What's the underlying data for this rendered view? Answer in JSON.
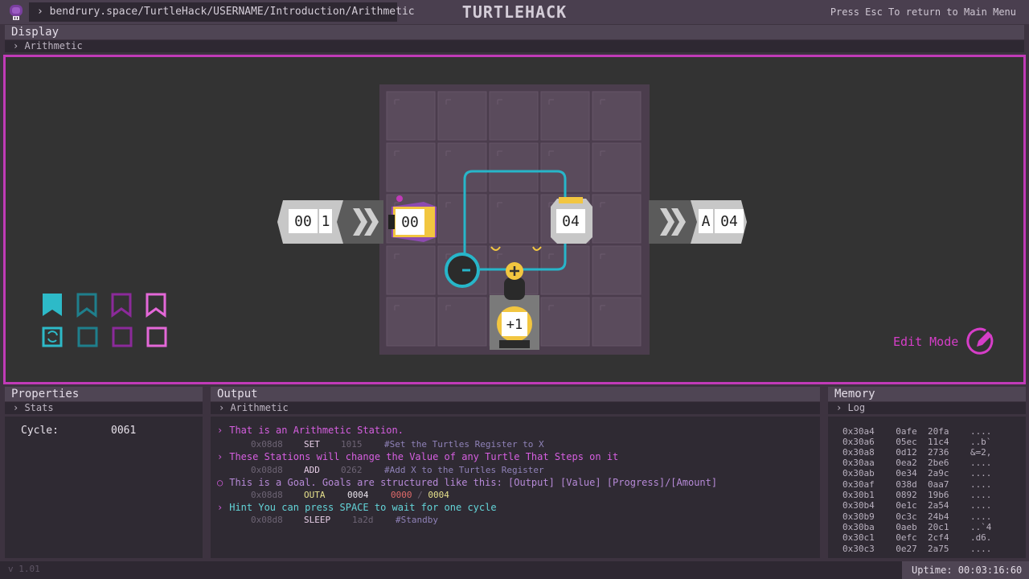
{
  "header": {
    "path": "› bendrury.space/TurtleHack/USERNAME/Introduction/Arithmetic",
    "title": "TURTLEHACK",
    "esc_hint": "Press Esc To return to Main Menu"
  },
  "display": {
    "title": "Display",
    "subtitle": "› Arithmetic",
    "input_station": {
      "value": "00",
      "count": "1"
    },
    "turtle": {
      "register": "00"
    },
    "goal": {
      "value": "04"
    },
    "output_station": {
      "label": "A",
      "value": "04"
    },
    "add_station": {
      "label": "+1"
    },
    "edit_mode_label": "Edit Mode",
    "colors": {
      "border": "#c13bb8",
      "path": "#27b6c9",
      "teal": "#2dbac8",
      "purple": "#8b2a9a",
      "pink": "#e468d8"
    }
  },
  "properties": {
    "title": "Properties",
    "subtitle": "› Stats",
    "stats": [
      {
        "label": "Cycle:",
        "value": "0061"
      }
    ]
  },
  "output": {
    "title": "Output",
    "subtitle": "› Arithmetic",
    "lines": [
      {
        "bullet": "›",
        "text": "That is an Arithmetic Station.",
        "addr": "0x08d8",
        "op": "SET",
        "arg": "1015",
        "comment": "#Set the Turtles Register to X"
      },
      {
        "bullet": "›",
        "text": "These Stations will change the Value of any Turtle That Steps on it",
        "addr": "0x08d8",
        "op": "ADD",
        "arg": "0262",
        "comment": "#Add X to the Turtles Register"
      },
      {
        "bullet": "○",
        "text": "This is a Goal. Goals are structured like this: [Output] [Value] [Progress]/[Amount]",
        "addr": "0x08d8",
        "op": "OUTA",
        "arg": "0004",
        "progress": "0000",
        "sep": "/",
        "amount": "0004"
      },
      {
        "bullet": "›",
        "text": "Hint You can press SPACE to wait for one cycle",
        "addr": "0x08d8",
        "op": "SLEEP",
        "arg": "1a2d",
        "comment": "#Standby"
      }
    ]
  },
  "memory": {
    "title": "Memory",
    "subtitle": "› Log",
    "rows": [
      "0x30a4    0afe  20fa    ....",
      "0x30a6    05ec  11c4    ..b`",
      "0x30a8    0d12  2736    &=2,",
      "0x30aa    0ea2  2be6    ....",
      "0x30ab    0e34  2a9c    ....",
      "0x30af    038d  0aa7    ....",
      "0x30b1    0892  19b6    ....",
      "0x30b4    0e1c  2a54    ....",
      "0x30b9    0c3c  24b4    ....",
      "0x30ba    0aeb  20c1    ..`4",
      "0x30c1    0efc  2cf4    .d6.",
      "0x30c3    0e27  2a75    ...."
    ]
  },
  "footer": {
    "version": "v 1.01",
    "uptime": "Uptime: 00:03:16:60"
  }
}
